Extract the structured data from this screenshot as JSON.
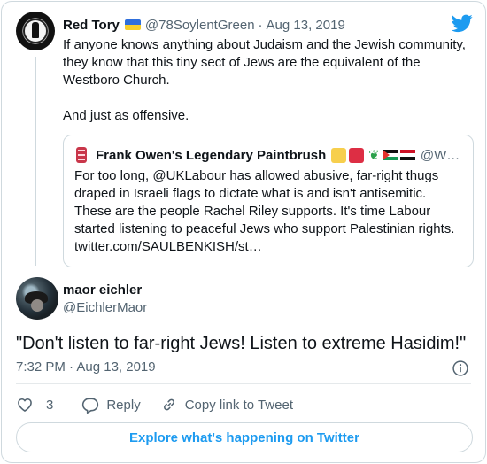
{
  "parent_tweet": {
    "author_name": "Red Tory",
    "author_handle": "@78SoylentGreen",
    "separator": "·",
    "date": "Aug 13, 2019",
    "text_line1": "If anyone knows anything about Judaism and the Jewish community, they know that this tiny sect of Jews are the equivalent of the Westboro Church.",
    "text_line2": "And just as offensive."
  },
  "quoted_tweet": {
    "author_name": "Frank Owen's Legendary Paintbrush",
    "author_handle": "@W…",
    "text": "For too long, @UKLabour has allowed abusive, far-right thugs draped in Israeli flags to dictate what is and isn't antisemitic. These are the people Rachel Riley supports. It's time Labour started listening to peaceful Jews who support Palestinian rights. twitter.com/SAULBENKISH/st…",
    "name_emoji_colors": [
      "#f7cf4d",
      "#dd2e44"
    ]
  },
  "main_tweet": {
    "author_name": "maor eichler",
    "author_handle": "@EichlerMaor",
    "text": "\"Don't listen to far-right Jews! Listen to extreme Hasidim!\"",
    "timestamp": "7:32 PM · Aug 13, 2019"
  },
  "actions": {
    "like_count": "3",
    "reply_label": "Reply",
    "copy_link_label": "Copy link to Tweet"
  },
  "explore_label": "Explore what's happening on Twitter",
  "colors": {
    "twitter_blue": "#1d9bf0",
    "muted": "#536471",
    "border": "#cfd9de"
  }
}
